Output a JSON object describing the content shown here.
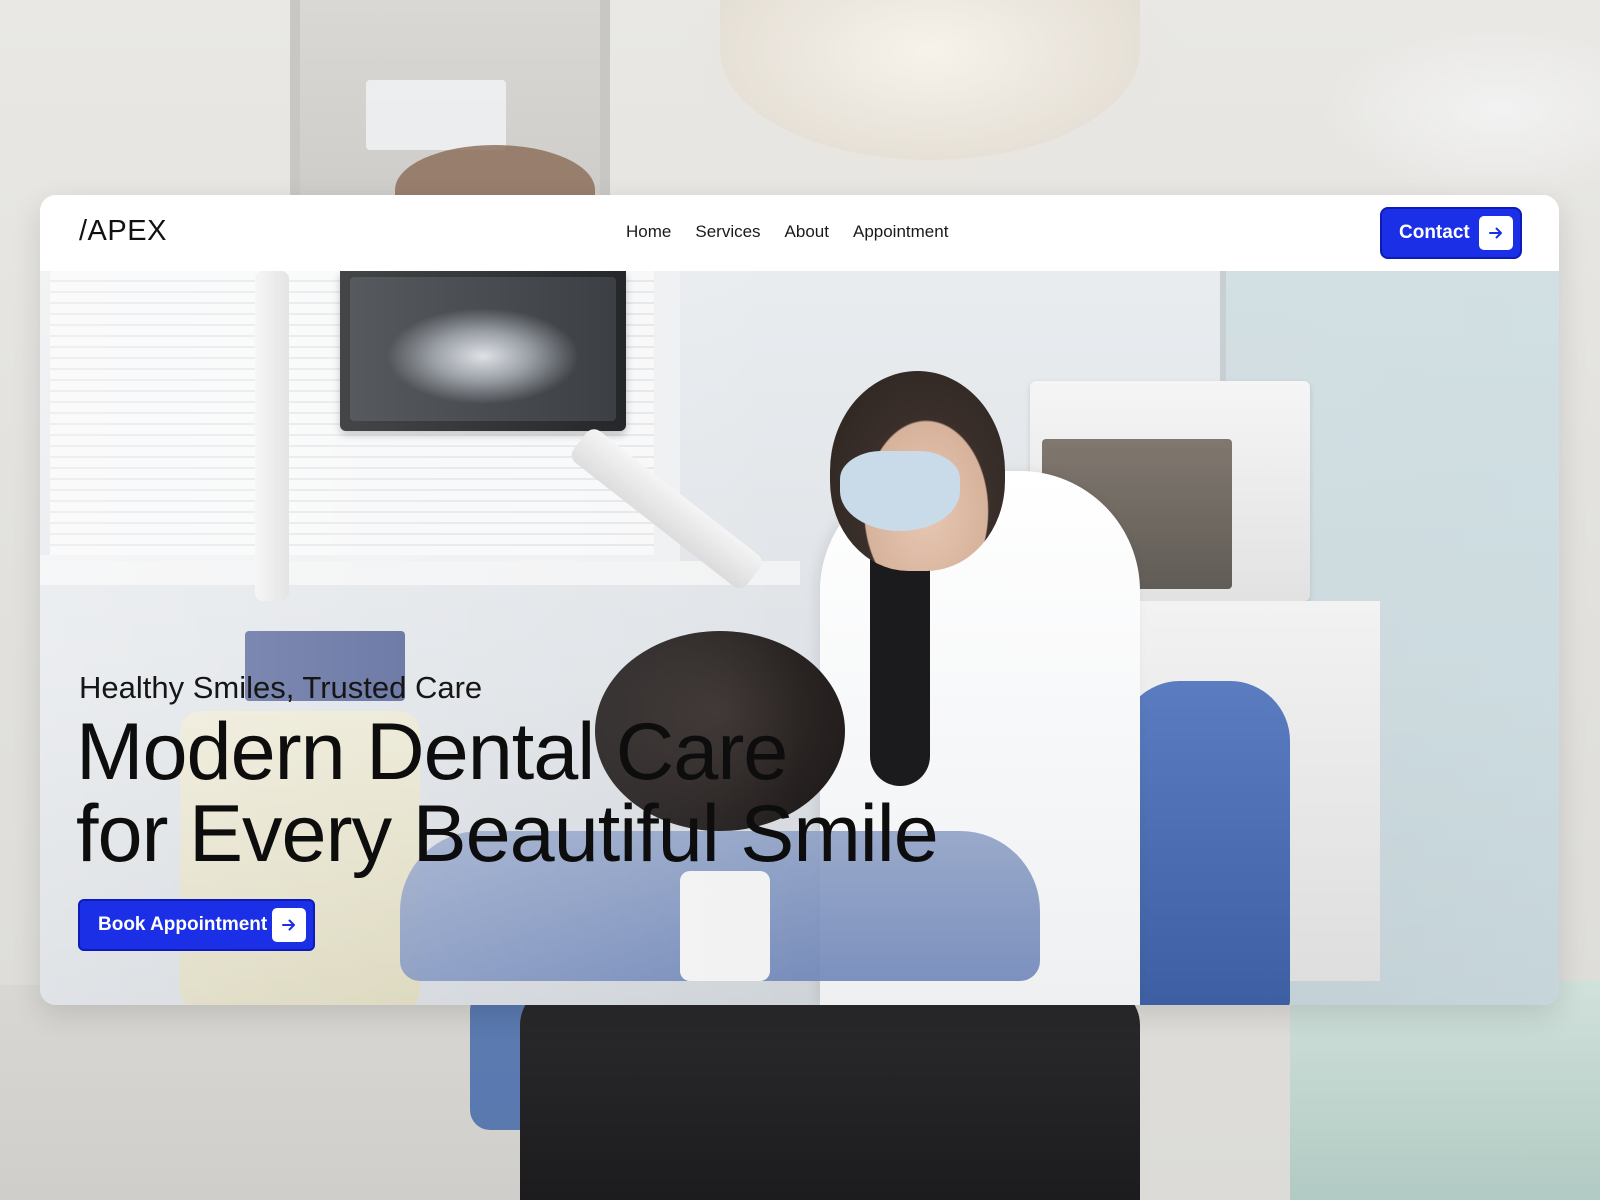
{
  "navbar": {
    "logo": "/APEX",
    "links": [
      {
        "label": "Home"
      },
      {
        "label": "Services"
      },
      {
        "label": "About"
      },
      {
        "label": "Appointment"
      }
    ],
    "contact_label": "Contact"
  },
  "hero": {
    "tagline": "Healthy Smiles, Trusted Care",
    "headline_line1": "Modern Dental Care",
    "headline_line2": "for Every Beautiful Smile",
    "cta_label": "Book Appointment"
  },
  "icons": {
    "contact_arrow": "arrow-right-icon",
    "cta_arrow": "arrow-right-icon"
  },
  "colors": {
    "accent": "#1a2fe6",
    "text": "#0d0d0d",
    "surface": "#ffffff"
  }
}
